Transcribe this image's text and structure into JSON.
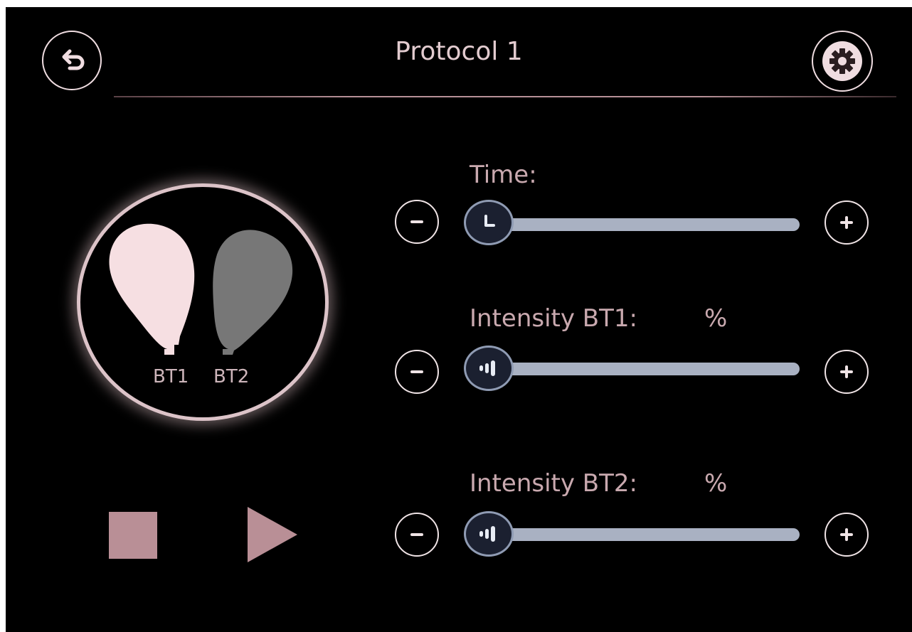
{
  "header": {
    "title": "Protocol 1",
    "back_icon": "back-arrow-icon",
    "settings_icon": "gear-icon"
  },
  "bulbs": {
    "bt1_label": "BT1",
    "bt2_label": "BT2",
    "bt1_color": "#f6dfe2",
    "bt2_color": "#777777"
  },
  "controls": {
    "time": {
      "label": "Time:",
      "knob_icon": "clock-icon",
      "level": 0
    },
    "intensity_bt1": {
      "label": "Intensity BT1:",
      "unit": "%",
      "knob_icon": "signal-icon",
      "level": 0
    },
    "intensity_bt2": {
      "label": "Intensity BT2:",
      "unit": "%",
      "knob_icon": "signal-icon",
      "level": 0
    },
    "minus_icon": "minus-icon",
    "plus_icon": "plus-icon"
  },
  "playback": {
    "stop_icon": "stop-icon",
    "play_icon": "play-icon"
  },
  "colors": {
    "accent": "#c9a9af",
    "slider_track": "#a9b1c2",
    "background": "#000000"
  }
}
